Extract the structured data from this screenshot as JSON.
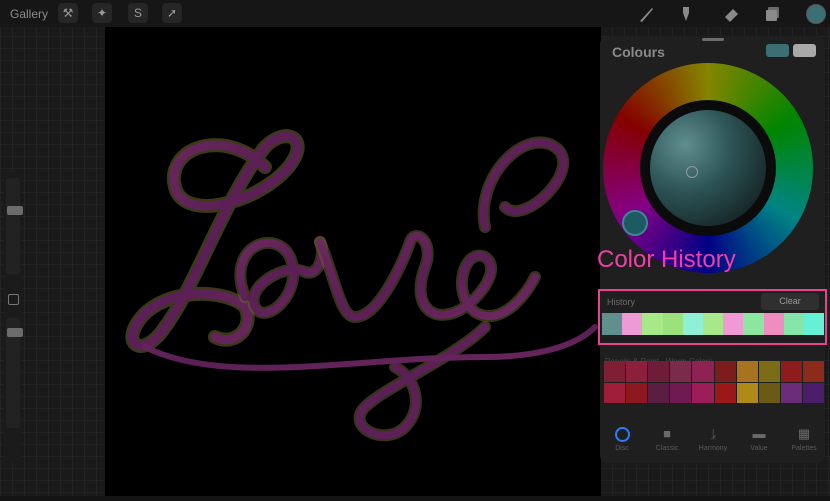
{
  "topbar": {
    "gallery_label": "Gallery",
    "left_tools": [
      "wrench-icon",
      "magic-wand-icon",
      "selection-s-icon",
      "arrow-cursor-icon"
    ],
    "right_tools": [
      "brush-icon",
      "smudge-icon",
      "eraser-icon",
      "layers-icon"
    ],
    "current_color": "#3c6f73"
  },
  "canvas": {
    "artwork_text": "Love"
  },
  "colours_panel": {
    "title": "Colours",
    "current_swatches": [
      "#3c6f73",
      "#a9a9a9"
    ]
  },
  "annotation": {
    "label": "Color History",
    "color": "#f040a6"
  },
  "history": {
    "title": "History",
    "clear_label": "Clear",
    "swatches": [
      "#5f8f8f",
      "#ee9ad6",
      "#a7e889",
      "#9be27d",
      "#8ff0d6",
      "#a8e88a",
      "#ef9ad5",
      "#8de6a0",
      "#ef8cc0",
      "#86e6aa",
      "#66f0d6"
    ]
  },
  "palette": {
    "title": "Pencils & Paint - Warm Colors",
    "swatches": [
      "#7f1f34",
      "#8b1f3c",
      "#6e1d38",
      "#7a2a4a",
      "#8e2252",
      "#7c1c1c",
      "#a7731f",
      "#7a6d15",
      "#8f1c1c",
      "#8c2b1c",
      "#a01e3a",
      "#8d1820",
      "#5a1e42",
      "#6f1a50",
      "#9c1d5a",
      "#9c1818",
      "#b08a18",
      "#6a5a14",
      "#6b2d7a",
      "#4b1d6a"
    ]
  },
  "tabs": [
    {
      "label": "Disc",
      "icon": "disc-icon",
      "active": true
    },
    {
      "label": "Classic",
      "icon": "square-icon",
      "active": false
    },
    {
      "label": "Harmony",
      "icon": "harmony-icon",
      "active": false
    },
    {
      "label": "Value",
      "icon": "value-sliders-icon",
      "active": false
    },
    {
      "label": "Palettes",
      "icon": "grid-icon",
      "active": false
    }
  ],
  "colors": {
    "annotation_border": "#e8438f",
    "active_tab": "#2f7cf6"
  }
}
